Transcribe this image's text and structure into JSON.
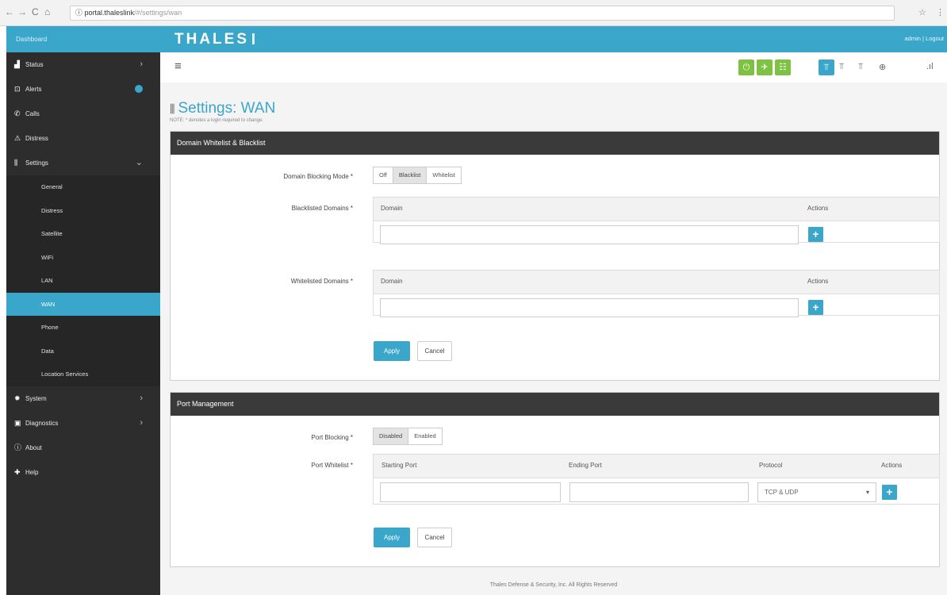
{
  "browser": {
    "back": "←",
    "forward": "→",
    "reload": "C",
    "home": "⌂",
    "info": "ⓘ",
    "url_host": "portal.thaleslink",
    "url_path": "/#/settings/wan",
    "star": "☆",
    "menu": "⋮"
  },
  "sidebar": {
    "top_label": "Dashboard",
    "items": [
      {
        "icon": "bar-chart-icon",
        "glyph": "▟",
        "label": "Status",
        "chevron": "›"
      },
      {
        "icon": "alert-icon",
        "glyph": "⊡",
        "label": "Alerts",
        "badge": true
      },
      {
        "icon": "phone-icon",
        "glyph": "✆",
        "label": "Calls"
      },
      {
        "icon": "warning-icon",
        "glyph": "⚠",
        "label": "Distress"
      },
      {
        "icon": "settings-icon",
        "glyph": "⫼",
        "label": "Settings",
        "chevron": "⌄"
      }
    ],
    "subitems": [
      "General",
      "Distress",
      "Satellite",
      "WiFi",
      "LAN",
      "WAN",
      "Phone",
      "Data",
      "Location Services"
    ],
    "active_subitem": 5,
    "items_bottom": [
      {
        "icon": "gear-icon",
        "glyph": "✹",
        "label": "System",
        "chevron": "›"
      },
      {
        "icon": "briefcase-icon",
        "glyph": "▣",
        "label": "Diagnostics",
        "chevron": "›"
      },
      {
        "icon": "info-icon",
        "glyph": "ⓘ",
        "label": "About"
      },
      {
        "icon": "help-icon",
        "glyph": "✚",
        "label": "Help"
      }
    ]
  },
  "header": {
    "brand": "THALES",
    "user": "admin | Logout"
  },
  "toolbar": {
    "menu_glyph": "≡",
    "power": "⏻",
    "satellite": "✈",
    "wifi": "☷",
    "net1": "⫪",
    "net2": "⫪",
    "net3": "⫪",
    "globe": "⊕",
    "signal": ".ıl"
  },
  "page": {
    "title_glyph": "⫼",
    "title": "Settings: WAN",
    "note": "NOTE: * denotes a login required to change."
  },
  "domain_panel": {
    "heading": "Domain Whitelist & Blacklist",
    "mode_label": "Domain Blocking Mode *",
    "mode_options": [
      "Off",
      "Blacklist",
      "Whitelist"
    ],
    "mode_selected": "Blacklist",
    "blacklist_label": "Blacklisted Domains *",
    "whitelist_label": "Whitelisted Domains *",
    "col_domain": "Domain",
    "col_actions": "Actions",
    "blacklist_value": "",
    "whitelist_value": "",
    "add": "+",
    "apply": "Apply",
    "cancel": "Cancel"
  },
  "port_panel": {
    "heading": "Port Management",
    "blocking_label": "Port Blocking *",
    "blocking_options": [
      "Disabled",
      "Enabled"
    ],
    "blocking_selected": "Disabled",
    "whitelist_label": "Port Whitelist *",
    "col_start": "Starting Port",
    "col_end": "Ending Port",
    "col_protocol": "Protocol",
    "col_actions": "Actions",
    "start_value": "",
    "end_value": "",
    "protocol_value": "TCP & UDP",
    "add": "+",
    "apply": "Apply",
    "cancel": "Cancel"
  },
  "footer": "Thales Defense & Security, Inc. All Rights Reserved",
  "colors": {
    "accent": "#3aa6c9",
    "sidebar": "#2d2d2d",
    "green": "#7dc242",
    "panel_head": "#3a3a3a"
  }
}
